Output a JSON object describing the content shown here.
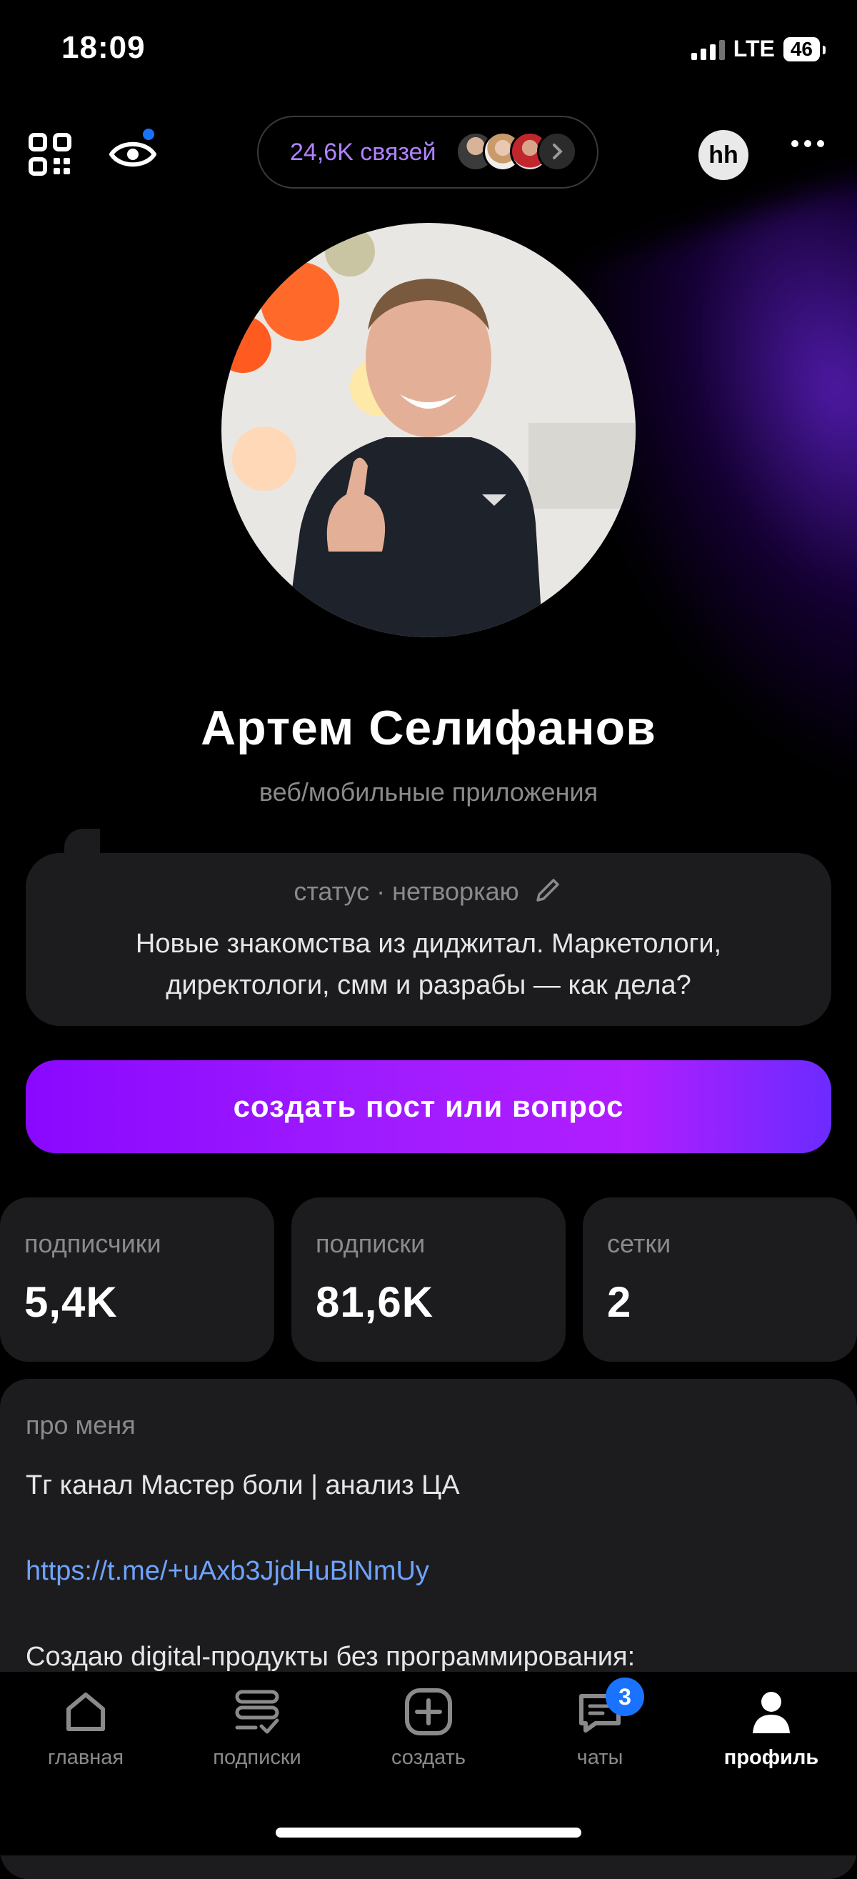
{
  "status_bar": {
    "time": "18:09",
    "network": "LTE",
    "battery": "46"
  },
  "header": {
    "connections_label": "24,6K связей",
    "hh_label": "hh"
  },
  "profile": {
    "name": "Артем Селифанов",
    "subtitle": "веб/мобильные приложения"
  },
  "status": {
    "label": "статус · нетворкаю",
    "text": "Новые знакомства из диджитал. Маркетологи, директологи, смм и разрабы — как дела?"
  },
  "cta_label": "создать пост или вопрос",
  "stats": [
    {
      "label": "подписчики",
      "value": "5,4K"
    },
    {
      "label": "подписки",
      "value": "81,6K"
    },
    {
      "label": "сетки",
      "value": "2"
    }
  ],
  "about": {
    "title": "про меня",
    "line1": "Тг канал Мастер боли | анализ ЦА",
    "link": "https://t.me/+uAxb3JjdHuBlNmUy",
    "line3": "Создаю digital-продукты без программирования:"
  },
  "tabs": [
    {
      "label": "главная",
      "icon": "home-icon"
    },
    {
      "label": "подписки",
      "icon": "feed-icon"
    },
    {
      "label": "создать",
      "icon": "plus-icon"
    },
    {
      "label": "чаты",
      "icon": "chat-icon",
      "badge": "3"
    },
    {
      "label": "профиль",
      "icon": "profile-icon"
    }
  ],
  "colors": {
    "accent_purple": "#9b10ff",
    "link_blue": "#6ea3ff",
    "badge_blue": "#1a73ff",
    "card_bg": "#1c1c1e"
  }
}
